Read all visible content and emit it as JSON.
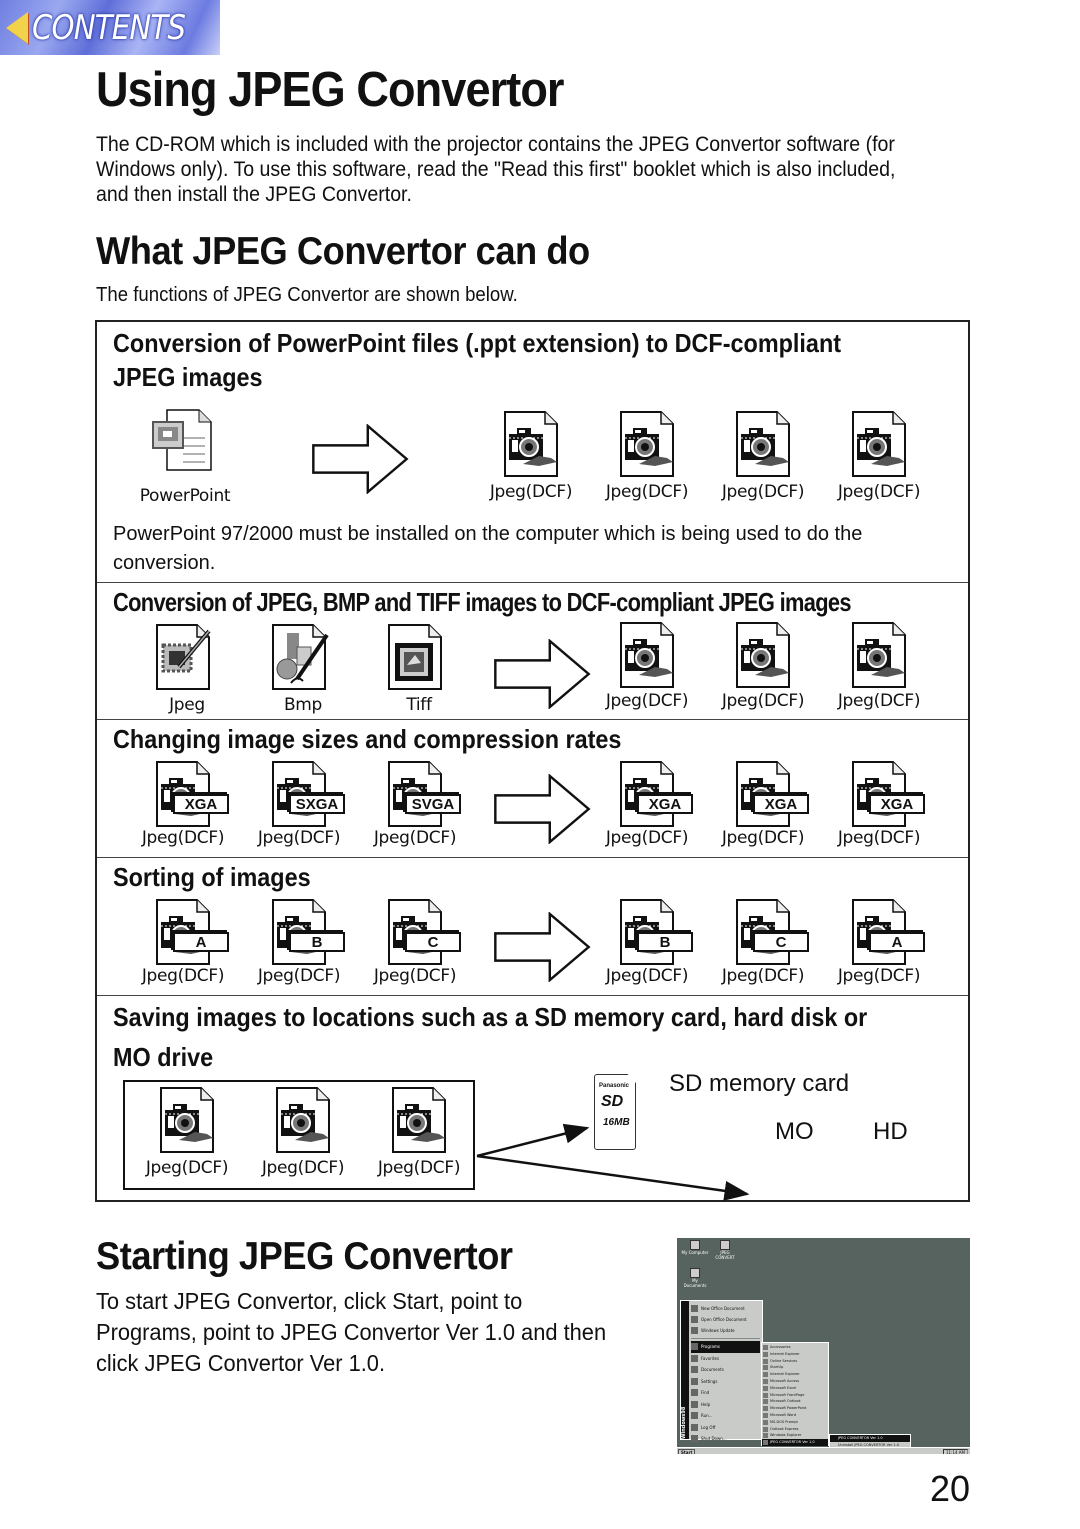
{
  "nav": {
    "contents_label": "CONTENTS"
  },
  "page": {
    "title": "Using JPEG Convertor",
    "intro": "The CD-ROM which is included with the projector contains the JPEG Convertor software (for Windows only). To use this software, read the \"Read this first\" booklet which is also included, and then install the JPEG Convertor.",
    "section_title": "What JPEG Convertor can do",
    "section_lead": "The functions of JPEG Convertor are shown below.",
    "page_number": "20"
  },
  "functions": [
    {
      "title_line1": "Conversion of PowerPoint files (.ppt extension) to DCF-compliant",
      "title_line2": "JPEG images",
      "inputs": [
        {
          "icon": "powerpoint-file-icon",
          "caption": "PowerPoint"
        }
      ],
      "outputs": [
        {
          "icon": "jpeg-dcf-file-icon",
          "caption": "Jpeg(DCF)"
        },
        {
          "icon": "jpeg-dcf-file-icon",
          "caption": "Jpeg(DCF)"
        },
        {
          "icon": "jpeg-dcf-file-icon",
          "caption": "Jpeg(DCF)"
        },
        {
          "icon": "jpeg-dcf-file-icon",
          "caption": "Jpeg(DCF)"
        }
      ],
      "note": "PowerPoint 97/2000 must be installed on the computer which is being used to do the conversion."
    },
    {
      "title_line1": "Conversion of JPEG, BMP and TIFF images to DCF-compliant JPEG images",
      "inputs": [
        {
          "icon": "jpeg-file-icon",
          "caption": "Jpeg"
        },
        {
          "icon": "bmp-file-icon",
          "caption": "Bmp"
        },
        {
          "icon": "tiff-file-icon",
          "caption": "Tiff"
        }
      ],
      "outputs": [
        {
          "icon": "jpeg-dcf-file-icon",
          "caption": "Jpeg(DCF)"
        },
        {
          "icon": "jpeg-dcf-file-icon",
          "caption": "Jpeg(DCF)"
        },
        {
          "icon": "jpeg-dcf-file-icon",
          "caption": "Jpeg(DCF)"
        }
      ]
    },
    {
      "title_line1": "Changing image sizes and compression rates",
      "inputs": [
        {
          "icon": "jpeg-dcf-file-icon",
          "badge": "XGA",
          "caption": "Jpeg(DCF)"
        },
        {
          "icon": "jpeg-dcf-file-icon",
          "badge": "SXGA",
          "caption": "Jpeg(DCF)"
        },
        {
          "icon": "jpeg-dcf-file-icon",
          "badge": "SVGA",
          "caption": "Jpeg(DCF)"
        }
      ],
      "outputs": [
        {
          "icon": "jpeg-dcf-file-icon",
          "badge": "XGA",
          "caption": "Jpeg(DCF)"
        },
        {
          "icon": "jpeg-dcf-file-icon",
          "badge": "XGA",
          "caption": "Jpeg(DCF)"
        },
        {
          "icon": "jpeg-dcf-file-icon",
          "badge": "XGA",
          "caption": "Jpeg(DCF)"
        }
      ]
    },
    {
      "title_line1": "Sorting of images",
      "inputs": [
        {
          "icon": "jpeg-dcf-file-icon",
          "badge": "A",
          "caption": "Jpeg(DCF)"
        },
        {
          "icon": "jpeg-dcf-file-icon",
          "badge": "B",
          "caption": "Jpeg(DCF)"
        },
        {
          "icon": "jpeg-dcf-file-icon",
          "badge": "C",
          "caption": "Jpeg(DCF)"
        }
      ],
      "outputs": [
        {
          "icon": "jpeg-dcf-file-icon",
          "badge": "B",
          "caption": "Jpeg(DCF)"
        },
        {
          "icon": "jpeg-dcf-file-icon",
          "badge": "C",
          "caption": "Jpeg(DCF)"
        },
        {
          "icon": "jpeg-dcf-file-icon",
          "badge": "A",
          "caption": "Jpeg(DCF)"
        }
      ]
    },
    {
      "title_line1": "Saving images to locations such as a SD memory card, hard disk or",
      "title_line2": "MO drive",
      "inputs": [
        {
          "icon": "jpeg-dcf-file-icon",
          "caption": "Jpeg(DCF)"
        },
        {
          "icon": "jpeg-dcf-file-icon",
          "caption": "Jpeg(DCF)"
        },
        {
          "icon": "jpeg-dcf-file-icon",
          "caption": "Jpeg(DCF)"
        }
      ],
      "destinations": {
        "sd_card_label": "SD memory card",
        "sd_card_brand": "Panasonic",
        "sd_card_logo": "SD",
        "sd_card_capacity": "16MB",
        "mo_label": "MO",
        "hd_label": "HD"
      }
    }
  ],
  "starting": {
    "title": "Starting JPEG Convertor",
    "text": "To start JPEG Convertor, click Start, point to Programs, point to JPEG Convertor Ver 1.0 and then click JPEG Convertor Ver 1.0."
  },
  "screenshot": {
    "desktop_icons": [
      "My Computer",
      "JPEG CONVERT",
      "My Documents"
    ],
    "start_menu_top": [
      "New Office Document",
      "Open Office Document",
      "Windows Update"
    ],
    "start_menu": [
      "Programs",
      "Favorites",
      "Documents",
      "Settings",
      "Find",
      "Help",
      "Run...",
      "Log Off",
      "Shut Down..."
    ],
    "programs_menu": [
      "Accessories",
      "Internet Explorer",
      "Online Services",
      "StartUp",
      "Internet Explorer",
      "Microsoft Access",
      "Microsoft Excel",
      "Microsoft FrontPage",
      "Microsoft Outlook",
      "Microsoft PowerPoint",
      "Microsoft Word",
      "MS-DOS Prompt",
      "Outlook Express",
      "Windows Explorer",
      "JPEG CONVERTOR Ver 1.0"
    ],
    "submenu": [
      "JPEG CONVERTOR Ver 1.0",
      "Uninstall JPEG CONVERTOR Ver 1.0"
    ],
    "start_label": "Start",
    "os_band": "Windows98",
    "clock": "11:14 AM"
  }
}
